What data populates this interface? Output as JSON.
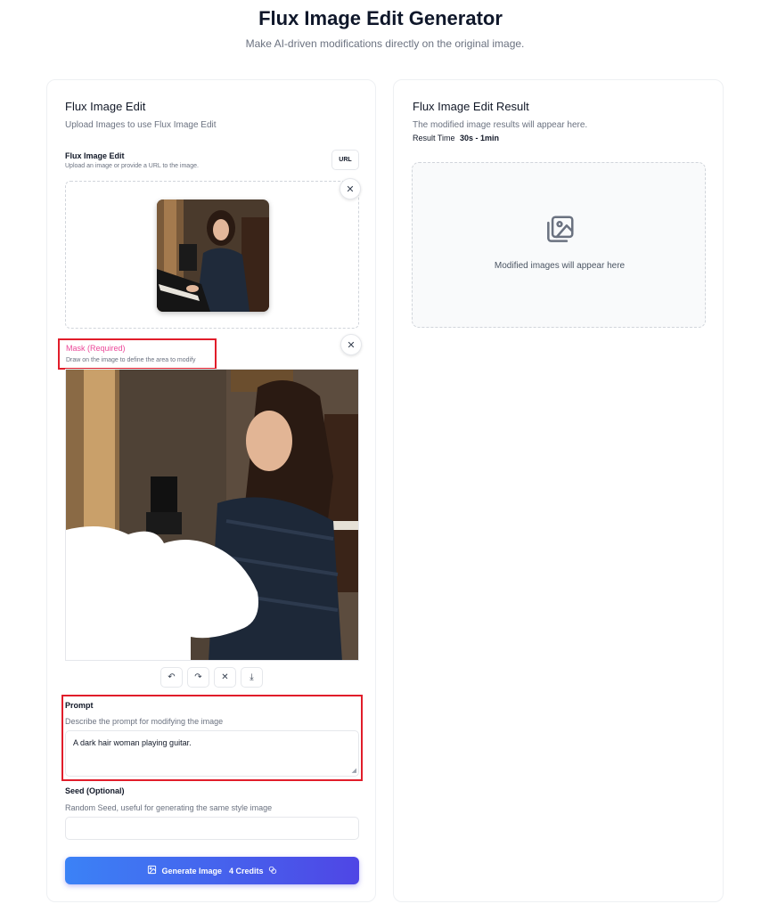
{
  "header": {
    "title": "Flux Image Edit Generator",
    "subtitle": "Make AI-driven modifications directly on the original image."
  },
  "left": {
    "title": "Flux Image Edit",
    "description": "Upload Images to use Flux Image Edit",
    "upload": {
      "label": "Flux Image Edit",
      "hint": "Upload an image or provide a URL to the image.",
      "url_button": "URL"
    },
    "mask": {
      "label": "Mask (Required)",
      "hint": "Draw on the image to define the area to modify"
    },
    "prompt": {
      "label": "Prompt",
      "hint": "Describe the prompt for modifying the image",
      "value": "A dark hair woman playing guitar."
    },
    "seed": {
      "label": "Seed (Optional)",
      "hint": "Random Seed, useful for generating the same style image",
      "value": ""
    },
    "generate": {
      "label": "Generate Image",
      "credits": "4 Credits"
    }
  },
  "right": {
    "title": "Flux Image Edit Result",
    "description": "The modified image results will appear here.",
    "result_time_label": "Result Time",
    "result_time_value": "30s - 1min",
    "placeholder": "Modified images will appear here"
  },
  "icons": {
    "close": "close-icon",
    "undo": "undo-icon",
    "redo": "redo-icon",
    "clear": "clear-icon",
    "download": "download-icon",
    "image": "image-icon",
    "generate": "image-icon",
    "credits": "coins-icon"
  },
  "colors": {
    "accent_start": "#3b82f6",
    "accent_end": "#4f46e5",
    "highlight_border": "#e11d2a",
    "mask_label": "#ec4899"
  }
}
